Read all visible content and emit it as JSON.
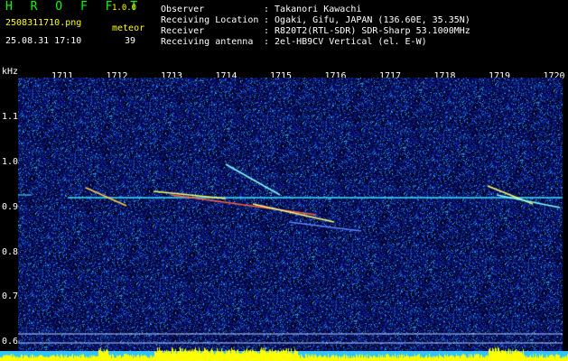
{
  "header": {
    "app_name": "H R O F F T",
    "app_version": "1.0.0",
    "filename": "2508311710.png",
    "timestamp": "25.08.31 17:10",
    "meteor_label": "meteor",
    "meteor_count": "39",
    "info": [
      {
        "key": "Observer",
        "value": ": Takanori Kawachi"
      },
      {
        "key": "Receiving Location",
        "value": ": Ogaki, Gifu, JAPAN (136.60E, 35.35N)"
      },
      {
        "key": "Receiver",
        "value": ": R820T2(RTL-SDR) SDR-Sharp 53.1000MHz"
      },
      {
        "key": "Receiving antenna",
        "value": ": 2el-HB9CV Vertical (el. E-W)"
      }
    ]
  },
  "axes": {
    "unit": "kHz",
    "x_ticks": [
      "1711",
      "1712",
      "1713",
      "1714",
      "1715",
      "1716",
      "1717",
      "1718",
      "1719",
      "1720"
    ],
    "y_ticks": [
      "1.1",
      "1.0",
      "0.9",
      "0.8",
      "0.7",
      "0.6"
    ]
  },
  "colors": {
    "background": "#000000",
    "noise": "#0a1aa0",
    "signal": "#ffff00",
    "carrier": "#40e0ff",
    "bar": "#2ec4ff"
  }
}
